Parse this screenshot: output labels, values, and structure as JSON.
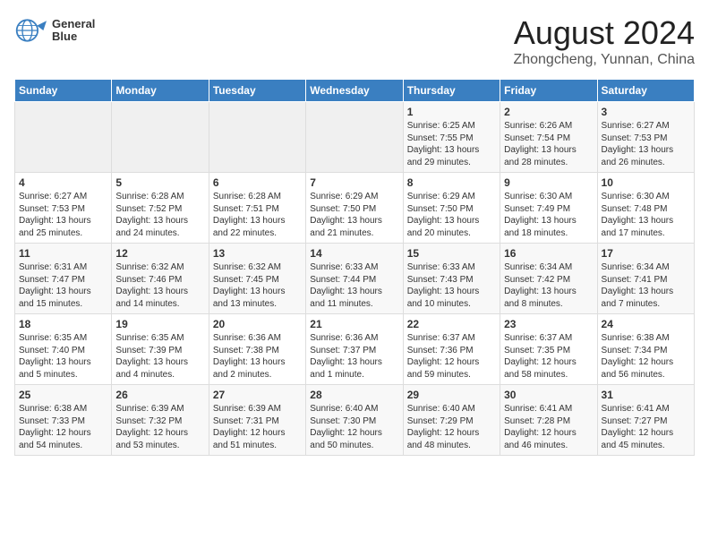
{
  "header": {
    "logo_line1": "General",
    "logo_line2": "Blue",
    "month_year": "August 2024",
    "location": "Zhongcheng, Yunnan, China"
  },
  "weekdays": [
    "Sunday",
    "Monday",
    "Tuesday",
    "Wednesday",
    "Thursday",
    "Friday",
    "Saturday"
  ],
  "weeks": [
    [
      {
        "day": "",
        "info": ""
      },
      {
        "day": "",
        "info": ""
      },
      {
        "day": "",
        "info": ""
      },
      {
        "day": "",
        "info": ""
      },
      {
        "day": "1",
        "info": "Sunrise: 6:25 AM\nSunset: 7:55 PM\nDaylight: 13 hours\nand 29 minutes."
      },
      {
        "day": "2",
        "info": "Sunrise: 6:26 AM\nSunset: 7:54 PM\nDaylight: 13 hours\nand 28 minutes."
      },
      {
        "day": "3",
        "info": "Sunrise: 6:27 AM\nSunset: 7:53 PM\nDaylight: 13 hours\nand 26 minutes."
      }
    ],
    [
      {
        "day": "4",
        "info": "Sunrise: 6:27 AM\nSunset: 7:53 PM\nDaylight: 13 hours\nand 25 minutes."
      },
      {
        "day": "5",
        "info": "Sunrise: 6:28 AM\nSunset: 7:52 PM\nDaylight: 13 hours\nand 24 minutes."
      },
      {
        "day": "6",
        "info": "Sunrise: 6:28 AM\nSunset: 7:51 PM\nDaylight: 13 hours\nand 22 minutes."
      },
      {
        "day": "7",
        "info": "Sunrise: 6:29 AM\nSunset: 7:50 PM\nDaylight: 13 hours\nand 21 minutes."
      },
      {
        "day": "8",
        "info": "Sunrise: 6:29 AM\nSunset: 7:50 PM\nDaylight: 13 hours\nand 20 minutes."
      },
      {
        "day": "9",
        "info": "Sunrise: 6:30 AM\nSunset: 7:49 PM\nDaylight: 13 hours\nand 18 minutes."
      },
      {
        "day": "10",
        "info": "Sunrise: 6:30 AM\nSunset: 7:48 PM\nDaylight: 13 hours\nand 17 minutes."
      }
    ],
    [
      {
        "day": "11",
        "info": "Sunrise: 6:31 AM\nSunset: 7:47 PM\nDaylight: 13 hours\nand 15 minutes."
      },
      {
        "day": "12",
        "info": "Sunrise: 6:32 AM\nSunset: 7:46 PM\nDaylight: 13 hours\nand 14 minutes."
      },
      {
        "day": "13",
        "info": "Sunrise: 6:32 AM\nSunset: 7:45 PM\nDaylight: 13 hours\nand 13 minutes."
      },
      {
        "day": "14",
        "info": "Sunrise: 6:33 AM\nSunset: 7:44 PM\nDaylight: 13 hours\nand 11 minutes."
      },
      {
        "day": "15",
        "info": "Sunrise: 6:33 AM\nSunset: 7:43 PM\nDaylight: 13 hours\nand 10 minutes."
      },
      {
        "day": "16",
        "info": "Sunrise: 6:34 AM\nSunset: 7:42 PM\nDaylight: 13 hours\nand 8 minutes."
      },
      {
        "day": "17",
        "info": "Sunrise: 6:34 AM\nSunset: 7:41 PM\nDaylight: 13 hours\nand 7 minutes."
      }
    ],
    [
      {
        "day": "18",
        "info": "Sunrise: 6:35 AM\nSunset: 7:40 PM\nDaylight: 13 hours\nand 5 minutes."
      },
      {
        "day": "19",
        "info": "Sunrise: 6:35 AM\nSunset: 7:39 PM\nDaylight: 13 hours\nand 4 minutes."
      },
      {
        "day": "20",
        "info": "Sunrise: 6:36 AM\nSunset: 7:38 PM\nDaylight: 13 hours\nand 2 minutes."
      },
      {
        "day": "21",
        "info": "Sunrise: 6:36 AM\nSunset: 7:37 PM\nDaylight: 13 hours\nand 1 minute."
      },
      {
        "day": "22",
        "info": "Sunrise: 6:37 AM\nSunset: 7:36 PM\nDaylight: 12 hours\nand 59 minutes."
      },
      {
        "day": "23",
        "info": "Sunrise: 6:37 AM\nSunset: 7:35 PM\nDaylight: 12 hours\nand 58 minutes."
      },
      {
        "day": "24",
        "info": "Sunrise: 6:38 AM\nSunset: 7:34 PM\nDaylight: 12 hours\nand 56 minutes."
      }
    ],
    [
      {
        "day": "25",
        "info": "Sunrise: 6:38 AM\nSunset: 7:33 PM\nDaylight: 12 hours\nand 54 minutes."
      },
      {
        "day": "26",
        "info": "Sunrise: 6:39 AM\nSunset: 7:32 PM\nDaylight: 12 hours\nand 53 minutes."
      },
      {
        "day": "27",
        "info": "Sunrise: 6:39 AM\nSunset: 7:31 PM\nDaylight: 12 hours\nand 51 minutes."
      },
      {
        "day": "28",
        "info": "Sunrise: 6:40 AM\nSunset: 7:30 PM\nDaylight: 12 hours\nand 50 minutes."
      },
      {
        "day": "29",
        "info": "Sunrise: 6:40 AM\nSunset: 7:29 PM\nDaylight: 12 hours\nand 48 minutes."
      },
      {
        "day": "30",
        "info": "Sunrise: 6:41 AM\nSunset: 7:28 PM\nDaylight: 12 hours\nand 46 minutes."
      },
      {
        "day": "31",
        "info": "Sunrise: 6:41 AM\nSunset: 7:27 PM\nDaylight: 12 hours\nand 45 minutes."
      }
    ]
  ]
}
